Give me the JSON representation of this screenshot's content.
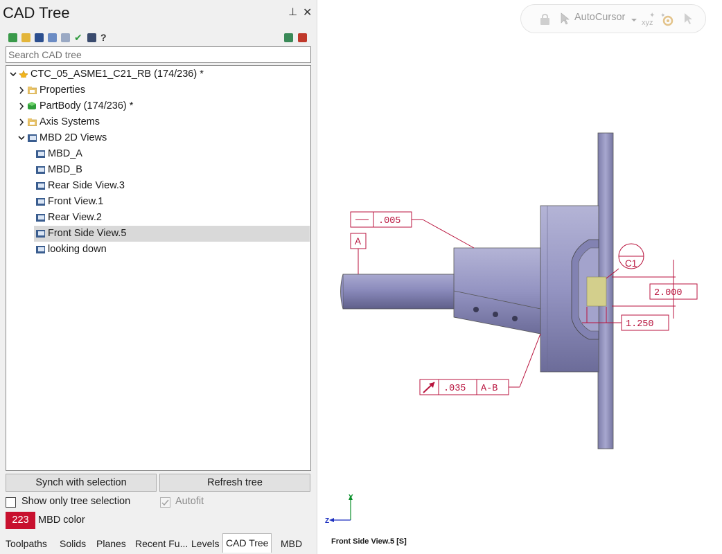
{
  "panel": {
    "title": "CAD Tree",
    "pin_glyph": "⊥",
    "close_glyph": "✕",
    "toolbar_icons": [
      "import-icon",
      "open-folder-icon",
      "save-icon",
      "document-icon",
      "notes-icon",
      "checkmark-icon",
      "camera-icon",
      "help-icon",
      "add-layer-icon",
      "remove-layer-icon"
    ],
    "search_placeholder": "Search CAD tree"
  },
  "tree": {
    "root": {
      "label": "CTC_05_ASME1_C21_RB (174/236) *",
      "icon": "star-icon"
    },
    "items": [
      {
        "label": "Properties",
        "icon": "folder-icon"
      },
      {
        "label": "PartBody (174/236) *",
        "icon": "green-cube-icon"
      },
      {
        "label": "Axis Systems",
        "icon": "folder-icon"
      },
      {
        "label": "MBD 2D Views",
        "icon": "view-icon"
      }
    ],
    "views": [
      {
        "label": "MBD_A"
      },
      {
        "label": "MBD_B"
      },
      {
        "label": "Rear Side View.3"
      },
      {
        "label": "Front View.1"
      },
      {
        "label": "Rear View.2"
      },
      {
        "label": "Front Side View.5"
      },
      {
        "label": "looking down"
      }
    ]
  },
  "buttons": {
    "synch": "Synch with selection",
    "refresh": "Refresh tree"
  },
  "options": {
    "show_only": "Show only tree selection",
    "autofit": "Autofit",
    "mbd_color_value": "223",
    "mbd_color_label": "MBD color"
  },
  "tabs": [
    "Toolpaths",
    "Solids",
    "Planes",
    "Recent Fu...",
    "Levels",
    "CAD Tree",
    "MBD"
  ],
  "viewport": {
    "autocursor_label": "AutoCursor",
    "view_name": "Front Side View.5 [S]",
    "axis_y": "Y",
    "axis_z": "Z",
    "annotations": {
      "datum_a": "A",
      "flatness_value": ".005",
      "runout_value": ".035",
      "runout_datum": "A-B",
      "dim_2000": "2.000",
      "dim_1250": "1.250",
      "c1_label": "C1"
    }
  },
  "colors": {
    "mbd": "#c8102e",
    "annotation": "#b8123c",
    "part": "#8f8fb8"
  }
}
